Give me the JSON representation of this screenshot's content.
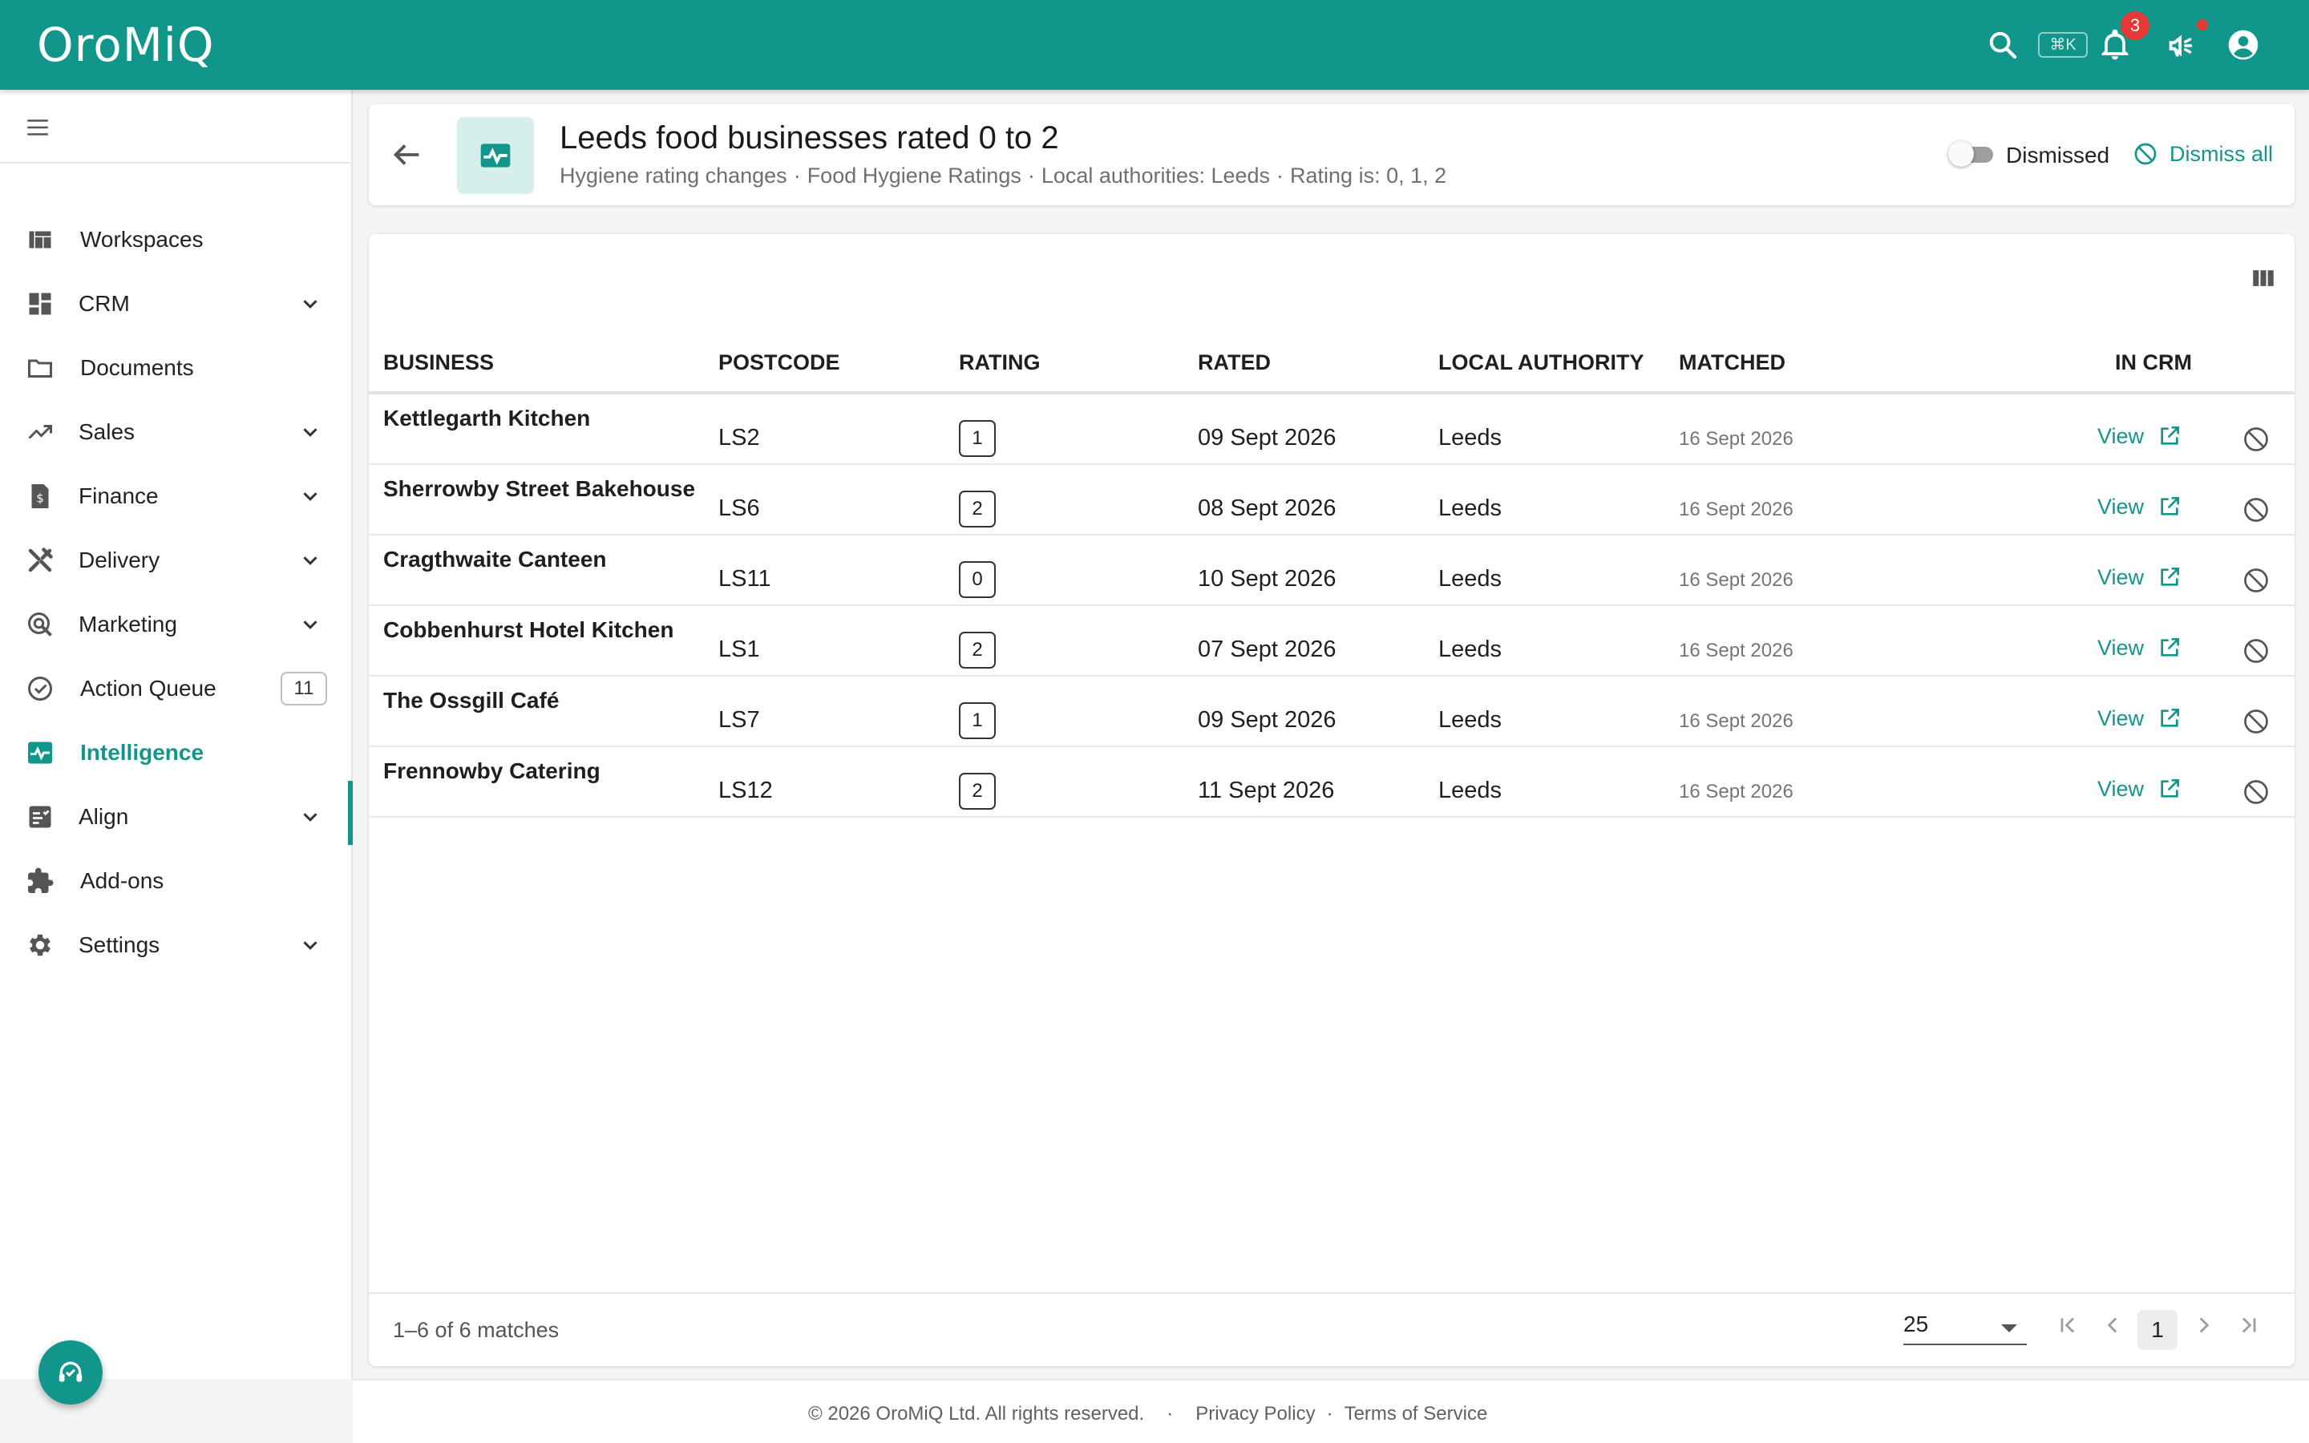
{
  "app": {
    "logo": "OroMiQ",
    "shortcut": "⌘K",
    "notification_count": "3",
    "accent_color": "#10968a"
  },
  "sidebar": {
    "items": [
      {
        "label": "Workspaces",
        "icon": "workspaces-icon"
      },
      {
        "label": "CRM",
        "icon": "crm-icon"
      },
      {
        "label": "Documents",
        "icon": "folder-icon"
      },
      {
        "label": "Sales",
        "icon": "trending-up-icon"
      },
      {
        "label": "Finance",
        "icon": "invoice-icon"
      },
      {
        "label": "Delivery",
        "icon": "tools-icon"
      },
      {
        "label": "Marketing",
        "icon": "marketing-icon"
      },
      {
        "label": "Action Queue",
        "icon": "check-circle-icon",
        "count": "11"
      },
      {
        "label": "Intelligence",
        "icon": "pulse-icon"
      },
      {
        "label": "Align",
        "icon": "align-icon"
      },
      {
        "label": "Add-ons",
        "icon": "puzzle-icon"
      },
      {
        "label": "Settings",
        "icon": "gear-icon"
      }
    ]
  },
  "header": {
    "title": "Leeds food businesses rated 0 to 2",
    "crumbs": [
      "Hygiene rating changes",
      "Food Hygiene Ratings",
      "Local authorities: Leeds",
      "Rating is: 0, 1, 2"
    ],
    "crumb_separator": "·",
    "dismissed_label": "Dismissed",
    "dismiss_all_label": "Dismiss all"
  },
  "table": {
    "columns": [
      "BUSINESS",
      "POSTCODE",
      "RATING",
      "RATED",
      "LOCAL AUTHORITY",
      "MATCHED",
      "IN CRM"
    ],
    "view_label": "View",
    "rows": [
      {
        "business": "Kettlegarth Kitchen",
        "postcode": "LS2",
        "rating": "1",
        "rated": "09 Sept 2026",
        "local_authority": "Leeds",
        "matched": "16 Sept 2026"
      },
      {
        "business": "Sherrowby Street Bakehouse",
        "postcode": "LS6",
        "rating": "2",
        "rated": "08 Sept 2026",
        "local_authority": "Leeds",
        "matched": "16 Sept 2026"
      },
      {
        "business": "Cragthwaite Canteen",
        "postcode": "LS11",
        "rating": "0",
        "rated": "10 Sept 2026",
        "local_authority": "Leeds",
        "matched": "16 Sept 2026"
      },
      {
        "business": "Cobbenhurst Hotel Kitchen",
        "postcode": "LS1",
        "rating": "2",
        "rated": "07 Sept 2026",
        "local_authority": "Leeds",
        "matched": "16 Sept 2026"
      },
      {
        "business": "The Ossgill Café",
        "postcode": "LS7",
        "rating": "1",
        "rated": "09 Sept 2026",
        "local_authority": "Leeds",
        "matched": "16 Sept 2026"
      },
      {
        "business": "Frennowby Catering",
        "postcode": "LS12",
        "rating": "2",
        "rated": "11 Sept 2026",
        "local_authority": "Leeds",
        "matched": "16 Sept 2026"
      }
    ],
    "matches_text": "1–6 of 6 matches",
    "per_page": "25",
    "current_page": "1"
  },
  "footer": {
    "copyright": "© 2026 OroMiQ Ltd. All rights reserved.",
    "separator": "·",
    "privacy": "Privacy Policy",
    "terms": "Terms of Service"
  }
}
